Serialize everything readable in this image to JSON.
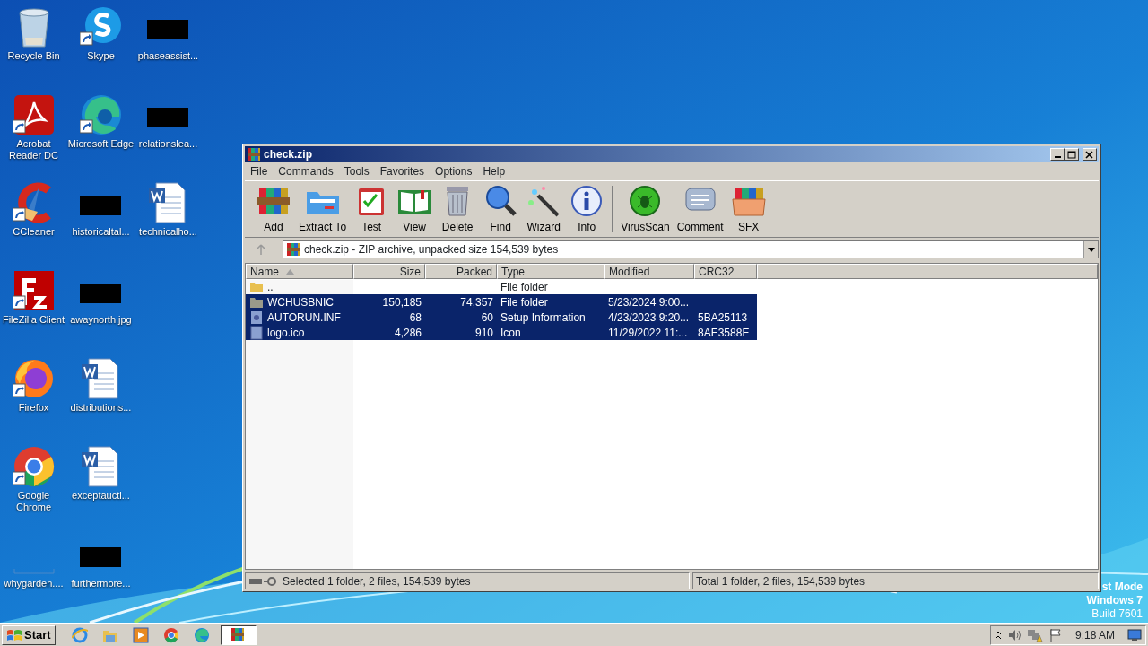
{
  "desktop_icons": [
    {
      "label": "Recycle Bin",
      "kind": "recycle",
      "shortcut": false
    },
    {
      "label": "Acrobat Reader DC",
      "kind": "acrobat",
      "shortcut": true
    },
    {
      "label": "CCleaner",
      "kind": "ccleaner",
      "shortcut": true
    },
    {
      "label": "FileZilla Client",
      "kind": "filezilla",
      "shortcut": true
    },
    {
      "label": "Firefox",
      "kind": "firefox",
      "shortcut": true
    },
    {
      "label": "Google Chrome",
      "kind": "chrome",
      "shortcut": true
    },
    {
      "label": "whygarden....",
      "kind": "blank",
      "shortcut": false
    },
    {
      "label": "Skype",
      "kind": "skype",
      "shortcut": true
    },
    {
      "label": "Microsoft Edge",
      "kind": "edge",
      "shortcut": true
    },
    {
      "label": "historicaltal...",
      "kind": "redacted",
      "shortcut": false
    },
    {
      "label": "awaynorth.jpg",
      "kind": "redacted",
      "shortcut": false
    },
    {
      "label": "distributions...",
      "kind": "word",
      "shortcut": false
    },
    {
      "label": "exceptaucti...",
      "kind": "word",
      "shortcut": false
    },
    {
      "label": "furthermore...",
      "kind": "redacted",
      "shortcut": false
    },
    {
      "label": "phaseassist...",
      "kind": "redacted",
      "shortcut": false
    },
    {
      "label": "relationslea...",
      "kind": "redacted",
      "shortcut": false
    },
    {
      "label": "technicalho...",
      "kind": "word",
      "shortcut": false
    }
  ],
  "window": {
    "title": "check.zip",
    "menu": [
      "File",
      "Commands",
      "Tools",
      "Favorites",
      "Options",
      "Help"
    ],
    "toolbar_groups": [
      [
        {
          "label": "Add",
          "kind": "add"
        },
        {
          "label": "Extract To",
          "kind": "extract"
        },
        {
          "label": "Test",
          "kind": "test"
        },
        {
          "label": "View",
          "kind": "view"
        },
        {
          "label": "Delete",
          "kind": "delete"
        },
        {
          "label": "Find",
          "kind": "find"
        },
        {
          "label": "Wizard",
          "kind": "wizard"
        },
        {
          "label": "Info",
          "kind": "info"
        }
      ],
      [
        {
          "label": "VirusScan",
          "kind": "virusscan"
        },
        {
          "label": "Comment",
          "kind": "comment"
        },
        {
          "label": "SFX",
          "kind": "sfx"
        }
      ]
    ],
    "address": "check.zip - ZIP archive, unpacked size 154,539 bytes",
    "columns": [
      {
        "label": "Name",
        "sorted": true
      },
      {
        "label": "Size",
        "sorted": false
      },
      {
        "label": "Packed",
        "sorted": false
      },
      {
        "label": "Type",
        "sorted": false
      },
      {
        "label": "Modified",
        "sorted": false
      },
      {
        "label": "CRC32",
        "sorted": false
      }
    ],
    "files": [
      {
        "name": "..",
        "kind": "up",
        "type": "File folder",
        "selected": false
      },
      {
        "name": "WCHUSBNIC",
        "kind": "folder",
        "size": "150,185",
        "packed": "74,357",
        "type": "File folder",
        "modified": "5/23/2024 9:00...",
        "selected": true
      },
      {
        "name": "AUTORUN.INF",
        "kind": "setup",
        "size": "68",
        "packed": "60",
        "type": "Setup Information",
        "modified": "4/23/2023 9:20...",
        "crc": "5BA25113",
        "selected": true
      },
      {
        "name": "logo.ico",
        "kind": "file",
        "size": "4,286",
        "packed": "910",
        "type": "Icon",
        "modified": "11/29/2022 11:...",
        "crc": "8AE3588E",
        "selected": true
      }
    ],
    "status_left": "Selected 1 folder, 2 files, 154,539 bytes",
    "status_right": "Total 1 folder, 2 files, 154,539 bytes"
  },
  "test_mode": [
    "st Mode",
    "Windows 7",
    "Build 7601"
  ],
  "taskbar": {
    "start": "Start",
    "apps": [
      {
        "kind": "ie",
        "active": false
      },
      {
        "kind": "explorer",
        "active": false
      },
      {
        "kind": "media",
        "active": false
      },
      {
        "kind": "chrome",
        "active": false
      },
      {
        "kind": "edge",
        "active": false
      },
      {
        "kind": "winrar",
        "active": true
      }
    ],
    "time": "9:18 AM"
  }
}
